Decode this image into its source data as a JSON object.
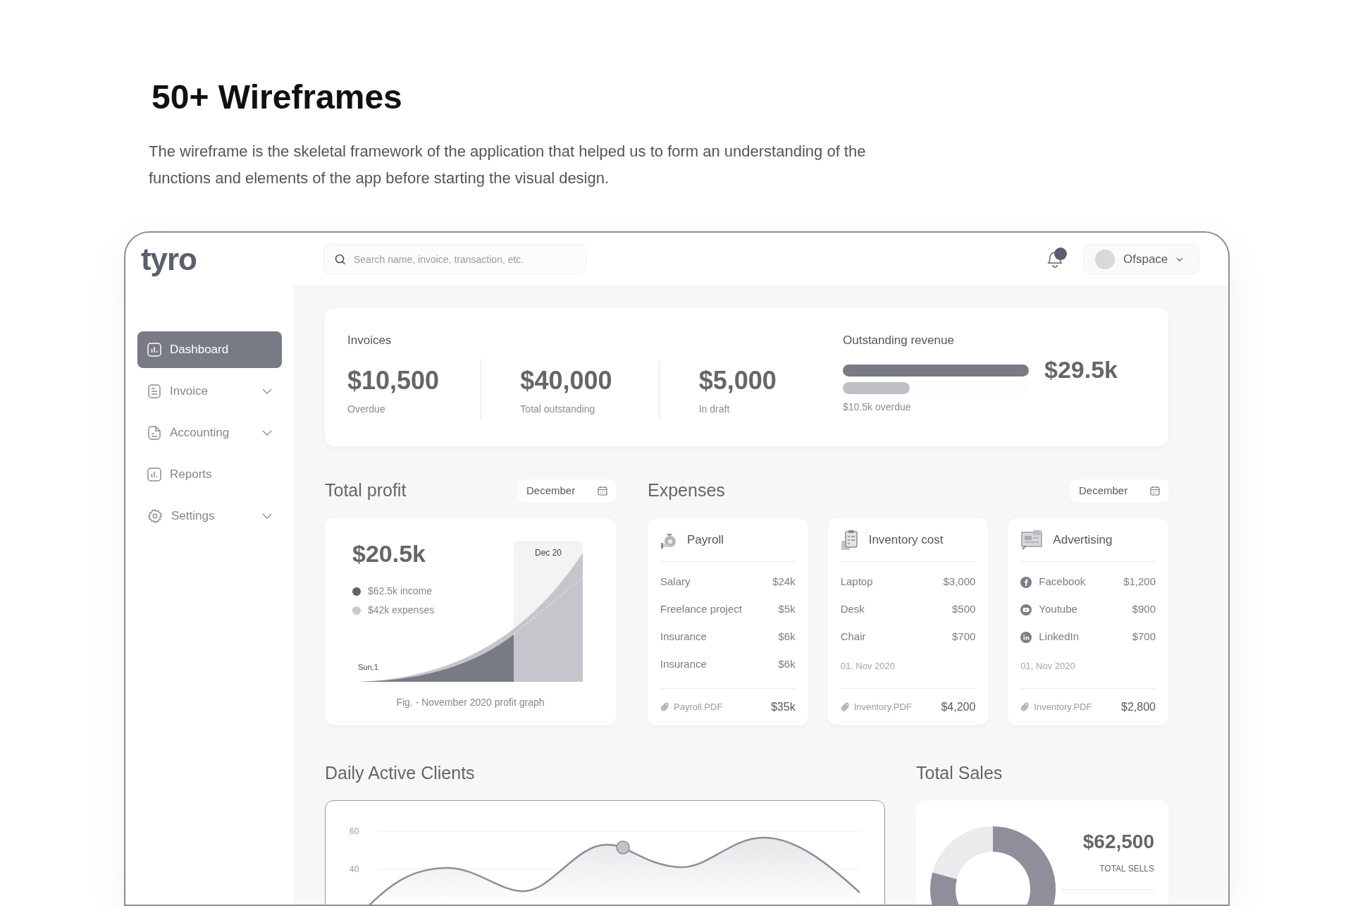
{
  "hero": {
    "title": "50+ Wireframes",
    "description": "The wireframe is the skeletal framework of the application that helped us to form an understanding of the functions and elements of the app before starting the visual design."
  },
  "app": {
    "logo": "tyro",
    "search": {
      "placeholder": "Search name, invoice, transaction, etc."
    },
    "account": {
      "name": "Ofspace"
    },
    "sidebar": {
      "items": [
        {
          "label": "Dashboard",
          "selected": true,
          "expandable": false
        },
        {
          "label": "Invoice",
          "selected": false,
          "expandable": true
        },
        {
          "label": "Accounting",
          "selected": false,
          "expandable": true
        },
        {
          "label": "Reports",
          "selected": false,
          "expandable": false
        },
        {
          "label": "Settings",
          "selected": false,
          "expandable": true
        }
      ]
    },
    "invoices": {
      "title": "Invoices",
      "stats": [
        {
          "value": "$10,500",
          "label": "Overdue"
        },
        {
          "value": "$40,000",
          "label": "Total outstanding"
        },
        {
          "value": "$5,000",
          "label": "In draft"
        }
      ]
    },
    "outstanding_revenue": {
      "title": "Outstanding revenue",
      "amount": "$29.5k",
      "bars": [
        {
          "kind": "total",
          "level": 1
        },
        {
          "kind": "overdue",
          "level": 0.36
        }
      ],
      "note": "$10.5k overdue"
    },
    "total_profit": {
      "title": "Total profit",
      "period": "December",
      "amount": "$20.5k",
      "legend": [
        {
          "label": "$62.5k income",
          "color": "#5f6272"
        },
        {
          "label": "$42k expenses",
          "color": "#c9cacf"
        }
      ],
      "highlight_label": "Dec 20",
      "start_label": "Sun,1",
      "caption": "Fig. - November 2020 profit graph"
    },
    "expenses": {
      "title": "Expenses",
      "period": "December",
      "cards": [
        {
          "title": "Payroll",
          "items": [
            {
              "label": "Salary",
              "amount": "$24k"
            },
            {
              "label": "Freelance project",
              "amount": "$5k"
            },
            {
              "label": "Insurance",
              "amount": "$6k"
            },
            {
              "label": "Insurance",
              "amount": "$6k"
            }
          ],
          "attachment": "Payroll.PDF",
          "total": "$35k"
        },
        {
          "title": "Inventory cost",
          "items": [
            {
              "label": "Laptop",
              "amount": "$3,000"
            },
            {
              "label": "Desk",
              "amount": "$500"
            },
            {
              "label": "Chair",
              "amount": "$700"
            }
          ],
          "date": "01, Nov 2020",
          "attachment": "Inventory.PDF",
          "total": "$4,200"
        },
        {
          "title": "Advertising",
          "items": [
            {
              "label": "Facebook",
              "amount": "$1,200"
            },
            {
              "label": "Youtube",
              "amount": "$900"
            },
            {
              "label": "LinkedIn",
              "amount": "$700"
            }
          ],
          "date": "01, Nov 2020",
          "attachment": "Inventory.PDF",
          "total": "$2,800"
        }
      ]
    },
    "daily_active_clients": {
      "title": "Daily Active Clients",
      "y_axis_labels": [
        "60",
        "40"
      ]
    },
    "total_sales": {
      "title": "Total Sales",
      "amount": "$62,500",
      "label": "TOTAL SELLS"
    }
  }
}
